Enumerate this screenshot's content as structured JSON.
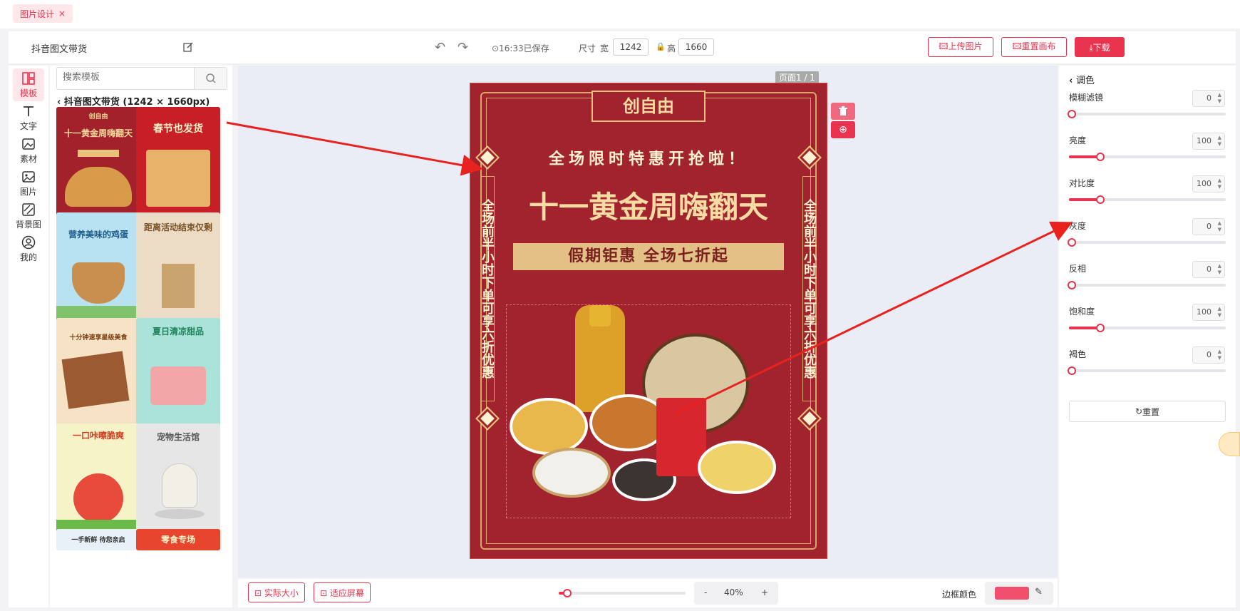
{
  "tab": {
    "label": "图片设计",
    "close": "×"
  },
  "topbar": {
    "project_name": "抖音图文带货",
    "saved_text": "⊙16:33已保存",
    "size_label": "尺寸",
    "width_label": "宽",
    "width_value": "1242",
    "height_label": "高",
    "height_value": "1660",
    "upload_label": "🖾上传图片",
    "reset_canvas_label": "🖾重置画布",
    "download_label": "⤓下载"
  },
  "leftrail": {
    "items": [
      {
        "label": "模板",
        "icon": "template-icon"
      },
      {
        "label": "文字",
        "icon": "text-icon"
      },
      {
        "label": "素材",
        "icon": "material-icon"
      },
      {
        "label": "图片",
        "icon": "image-icon"
      },
      {
        "label": "背景图",
        "icon": "background-icon"
      },
      {
        "label": "我的",
        "icon": "user-icon"
      }
    ]
  },
  "templates": {
    "search_placeholder": "搜索模板",
    "title": "抖音图文带货 (1242 × 1660px)",
    "items": [
      {
        "title": "十一黄金周嗨翻天"
      },
      {
        "title": "春节也发货"
      },
      {
        "title": "营养美味的鸡蛋"
      },
      {
        "title": "距离活动结束仅剩"
      },
      {
        "title": "十分钟速享星级美食"
      },
      {
        "title": "夏日清凉甜品"
      },
      {
        "title": "一口咔嚓脆爽"
      },
      {
        "title": "宠物生活馆"
      },
      {
        "title": "一手新鲜 待您亲启"
      },
      {
        "title": "零食专场"
      }
    ]
  },
  "canvas": {
    "page_indicator": "页面1 / 1",
    "poster": {
      "brand": "创自由",
      "subtitle": "全场限时特惠开抢啦！",
      "headline": "十一黄金周嗨翻天",
      "banner": "假期钜惠 全场七折起",
      "side_text_left": "全场前半小时下单可享六折优惠",
      "side_text_right": "全场前半小时下单可享六折优惠"
    }
  },
  "bottombar": {
    "actual_size_label": "⊡ 实际大小",
    "fit_screen_label": "⊡ 适应屏幕",
    "zoom_minus": "-",
    "zoom_value": "40%",
    "zoom_plus": "+",
    "zoom_fraction": 0.07,
    "border_label": "边框颜色",
    "border_color": "#f24f6e"
  },
  "adjust": {
    "title": "调色",
    "items": [
      {
        "label": "模糊滤镜",
        "value": "0",
        "fraction": 0.0
      },
      {
        "label": "亮度",
        "value": "100",
        "fraction": 0.18
      },
      {
        "label": "对比度",
        "value": "100",
        "fraction": 0.18
      },
      {
        "label": "灰度",
        "value": "0",
        "fraction": 0.0
      },
      {
        "label": "反相",
        "value": "0",
        "fraction": 0.0
      },
      {
        "label": "饱和度",
        "value": "100",
        "fraction": 0.18
      },
      {
        "label": "褐色",
        "value": "0",
        "fraction": 0.0
      }
    ],
    "reset_label": "重置"
  },
  "colors": {
    "accent": "#e8344e",
    "poster_red": "#a0232d",
    "gold": "#f3d89a"
  }
}
